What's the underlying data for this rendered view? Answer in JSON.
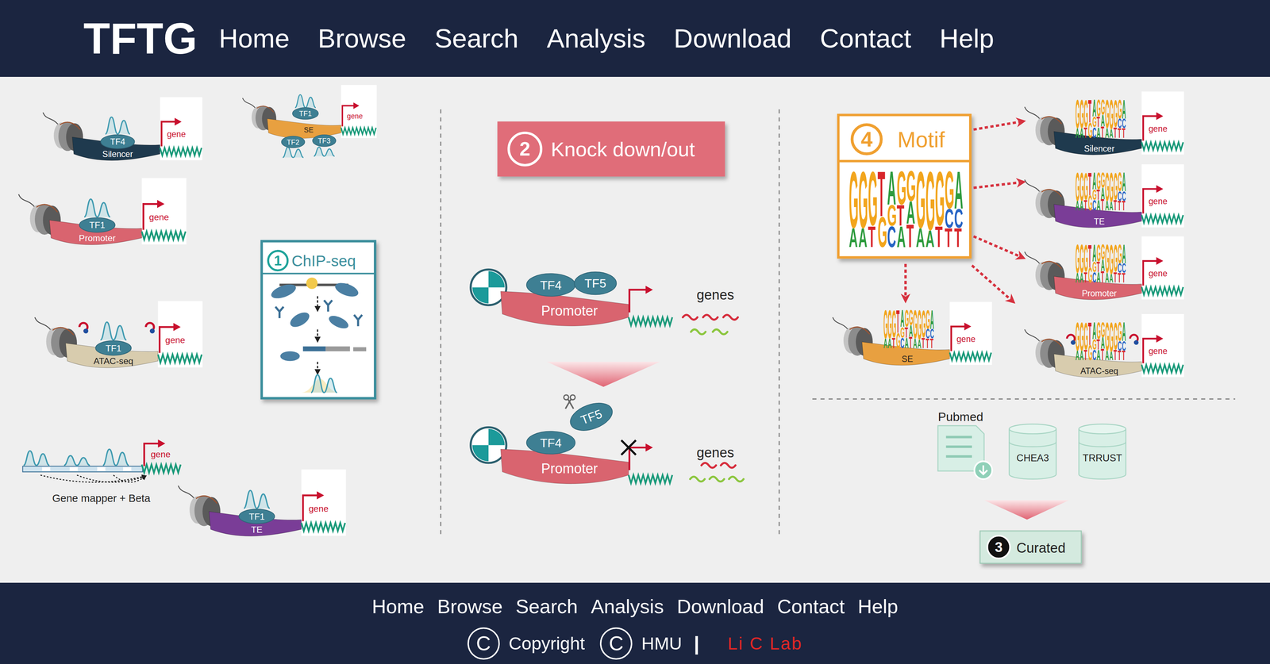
{
  "nav": {
    "logo": "TFTG",
    "items": [
      "Home",
      "Browse",
      "Search",
      "Analysis",
      "Download",
      "Contact",
      "Help"
    ]
  },
  "regulatory_elements": [
    {
      "kind": "single",
      "region": "Silencer",
      "tfs": [
        "TF4"
      ],
      "gene": "gene",
      "color": "#1f3a4e"
    },
    {
      "kind": "cluster",
      "region": "SE",
      "tfs": [
        "TF1",
        "TF2",
        "TF3"
      ],
      "gene": "gene",
      "color": "#e8a040"
    },
    {
      "kind": "single",
      "region": "Promoter",
      "tfs": [
        "TF1"
      ],
      "gene": "gene",
      "color": "#d9646f"
    },
    {
      "kind": "accessible",
      "region": "ATAC-seq",
      "tfs": [
        "TF1"
      ],
      "gene": "gene",
      "color": "#d8ccae"
    },
    {
      "kind": "single",
      "region": "TE",
      "tfs": [
        "TF1"
      ],
      "gene": "gene",
      "color": "#7a3d97"
    }
  ],
  "gene_mapper": {
    "label": "Gene mapper + Beta",
    "gene": "gene"
  },
  "chip_seq": {
    "number": "1",
    "label": "ChIP-seq"
  },
  "knockdown": {
    "number": "2",
    "label": "Knock down/out",
    "states": [
      {
        "tfs": [
          "TF4",
          "TF5"
        ],
        "region": "Promoter",
        "genes": "genes",
        "knocked": false
      },
      {
        "tfs": [
          "TF4",
          "TF5"
        ],
        "region": "Promoter",
        "genes": "genes",
        "knocked": true
      }
    ]
  },
  "motif": {
    "number": "4",
    "label": "Motif",
    "columns": [
      {
        "letters": [
          "G",
          "A"
        ],
        "level": 0.75
      },
      {
        "letters": [
          "G",
          "A"
        ],
        "level": 0.75
      },
      {
        "letters": [
          "G",
          "T"
        ],
        "level": 0.72
      },
      {
        "letters": [
          "T",
          "G"
        ],
        "level": 0.6
      },
      {
        "letters": [
          "A",
          "G",
          "C"
        ],
        "level": 0.45
      },
      {
        "letters": [
          "G",
          "T",
          "A"
        ],
        "level": 0.45
      },
      {
        "letters": [
          "G",
          "A",
          "T"
        ],
        "level": 0.4
      },
      {
        "letters": [
          "G",
          "A"
        ],
        "level": 0.75
      },
      {
        "letters": [
          "G",
          "A"
        ],
        "level": 0.78
      },
      {
        "letters": [
          "G",
          "T"
        ],
        "level": 0.72
      },
      {
        "letters": [
          "G",
          "C",
          "T"
        ],
        "level": 0.5
      },
      {
        "letters": [
          "A",
          "C",
          "T"
        ],
        "level": 0.5
      }
    ]
  },
  "motif_targets": [
    {
      "kind": "single",
      "region": "Silencer",
      "gene": "gene",
      "color": "#1f3a4e"
    },
    {
      "kind": "single",
      "region": "TE",
      "gene": "gene",
      "color": "#7a3d97"
    },
    {
      "kind": "single",
      "region": "Promoter",
      "gene": "gene",
      "color": "#d9646f"
    },
    {
      "kind": "single",
      "region": "SE",
      "gene": "gene",
      "color": "#e8a040"
    },
    {
      "kind": "accessible",
      "region": "ATAC-seq",
      "gene": "gene",
      "color": "#d8ccae"
    }
  ],
  "curated": {
    "sources": [
      {
        "kind": "document",
        "label": "Pubmed"
      },
      {
        "kind": "database",
        "label": "CHEA3"
      },
      {
        "kind": "database",
        "label": "TRRUST"
      }
    ],
    "number": "3",
    "label": "Curated"
  },
  "footer": {
    "links": [
      "Home",
      "Browse",
      "Search",
      "Analysis",
      "Download",
      "Contact",
      "Help"
    ],
    "copyright": [
      {
        "mark": "C",
        "text": "Copyright"
      },
      {
        "mark": "C",
        "text": "HMU"
      }
    ],
    "separator": "|",
    "lab": "Li C Lab"
  }
}
